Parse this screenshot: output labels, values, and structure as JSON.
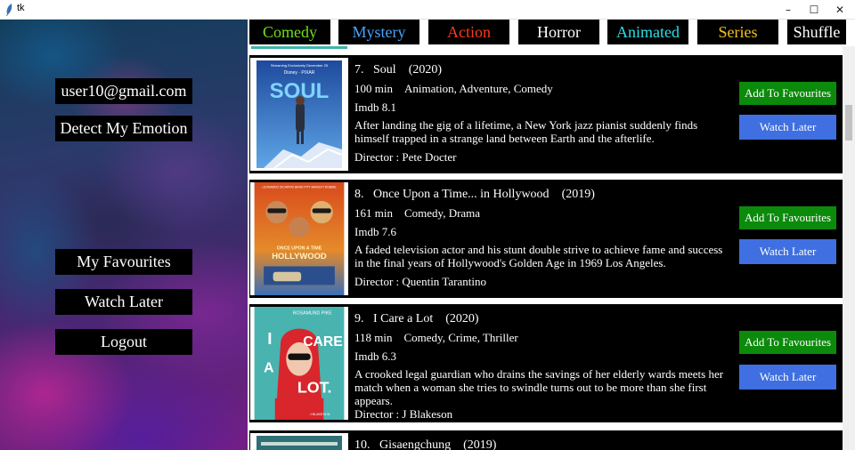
{
  "window": {
    "title": "tk"
  },
  "sidebar": {
    "email": "user10@gmail.com",
    "detect_emotion": "Detect My Emotion",
    "my_favourites": "My Favourites",
    "watch_later": "Watch Later",
    "logout": "Logout"
  },
  "genres": {
    "comedy": "Comedy",
    "mystery": "Mystery",
    "action": "Action",
    "horror": "Horror",
    "animated": "Animated",
    "series": "Series",
    "shuffle": "Shuffle"
  },
  "genre_colors": {
    "comedy": "#6fe01a",
    "mystery": "#4aa3ff",
    "action": "#ff3a17",
    "horror": "#ffffff",
    "animated": "#2ae0e6",
    "series": "#f5c21b"
  },
  "movies": [
    {
      "number": "7.",
      "title": "Soul",
      "year": "(2020)",
      "runtime": "100 min",
      "genres": "Animation, Adventure, Comedy",
      "imdb": "Imdb 8.1",
      "description": "After landing the gig of a lifetime, a New York jazz pianist suddenly finds himself trapped in a strange land between Earth and the afterlife.",
      "director": "Director : Pete Docter",
      "add_fav_label": "Add To Favourites",
      "watch_later_label": "Watch Later"
    },
    {
      "number": "8.",
      "title": "Once Upon a Time... in Hollywood",
      "year": "(2019)",
      "runtime": "161 min",
      "genres": "Comedy, Drama",
      "imdb": "Imdb 7.6",
      "description": "A faded television actor and his stunt double strive to achieve fame and success in the final years of Hollywood's Golden Age in 1969 Los Angeles.",
      "director": "Director : Quentin Tarantino",
      "add_fav_label": "Add To Favourites",
      "watch_later_label": "Watch Later"
    },
    {
      "number": "9.",
      "title": "I Care a Lot",
      "year": "(2020)",
      "runtime": "118 min",
      "genres": "Comedy, Crime, Thriller",
      "imdb": "Imdb 6.3",
      "description": "A crooked legal guardian who drains the savings of her elderly wards meets her match when a woman she tries to swindle turns out to be more than she first appears.",
      "director": "Director : J Blakeson",
      "add_fav_label": "Add To Favourites",
      "watch_later_label": "Watch Later"
    },
    {
      "number": "10.",
      "title": "Gisaengchung",
      "year": "(2019)"
    }
  ],
  "posters": {
    "soul": {
      "top_line": "Streaming Exclusively December 25",
      "brand": "Disney · PIXAR",
      "title": "SOUL"
    },
    "ouatih": {
      "top_line": "LEONARDO DICAPRIO  BRAD PITT  MARGOT ROBBIE",
      "title_1": "ONCE UPON A TIME",
      "title_2": "HOLLYWOOD"
    },
    "icarealot": {
      "top_line": "ROSAMUND PIKE",
      "word_1": "I",
      "word_2": "CARE",
      "word_3": "A",
      "word_4": "LOT.",
      "bottom_line": "J BLAKESON"
    }
  }
}
